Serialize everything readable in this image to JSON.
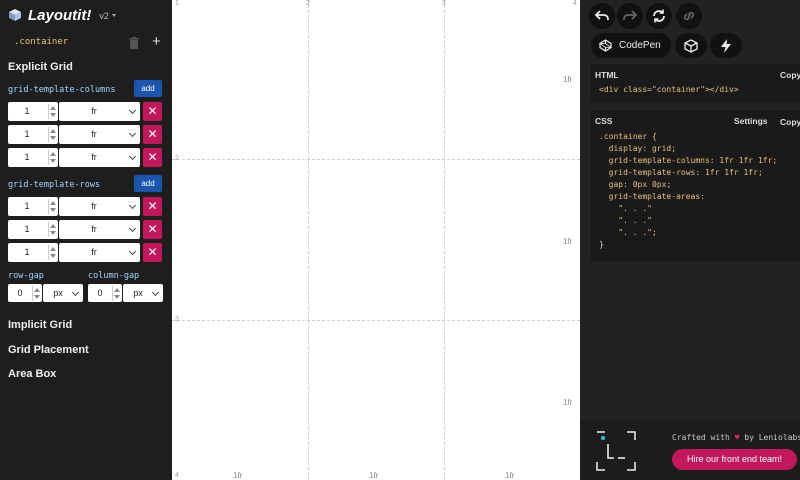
{
  "app": {
    "name": "Layoutit!",
    "version": "v2"
  },
  "container": {
    "name": ".container"
  },
  "explicit_grid": {
    "title": "Explicit Grid",
    "columns_label": "grid-template-columns",
    "rows_label": "grid-template-rows",
    "add_label": "add",
    "remove_label": "✕",
    "columns": [
      {
        "value": "1",
        "unit": "fr"
      },
      {
        "value": "1",
        "unit": "fr"
      },
      {
        "value": "1",
        "unit": "fr"
      }
    ],
    "rows": [
      {
        "value": "1",
        "unit": "fr"
      },
      {
        "value": "1",
        "unit": "fr"
      },
      {
        "value": "1",
        "unit": "fr"
      }
    ],
    "row_gap": {
      "label": "row-gap",
      "value": "0",
      "unit": "px"
    },
    "column_gap": {
      "label": "column-gap",
      "value": "0",
      "unit": "px"
    }
  },
  "sections": {
    "implicit_grid": "Implicit Grid",
    "grid_placement": "Grid Placement",
    "area_box": "Area Box"
  },
  "canvas": {
    "col_line_numbers": [
      "1",
      "2",
      "3",
      "4"
    ],
    "row_line_numbers": [
      "2",
      "3",
      "4"
    ],
    "col_track_labels": [
      "1fr",
      "1fr",
      "1fr"
    ],
    "row_track_labels": [
      "1fr",
      "1fr",
      "1fr"
    ]
  },
  "toolbar": {
    "codepen_label": "CodePen"
  },
  "html_panel": {
    "title": "HTML",
    "copy_label": "Copy",
    "code": "<div class=\"container\"></div>"
  },
  "css_panel": {
    "title": "CSS",
    "settings_label": "Settings",
    "copy_label": "Copy",
    "lines": [
      ".container {",
      "  display: grid;",
      "  grid-template-columns: 1fr 1fr 1fr;",
      "  grid-template-rows: 1fr 1fr 1fr;",
      "  gap: 0px 0px;",
      "  grid-template-areas:",
      "    \". . .\"",
      "    \". . .\"",
      "    \". . .\";",
      "}"
    ]
  },
  "footer": {
    "crafted_prefix": "Crafted with",
    "heart": "♥",
    "crafted_suffix": "by Leniolabs_",
    "hire_label": "Hire our front end team!"
  },
  "colors": {
    "accent_blue": "#1a56b0",
    "accent_pink": "#c2185b",
    "sidebar_bg": "#1e1e1e",
    "panel_bg": "#222222"
  }
}
